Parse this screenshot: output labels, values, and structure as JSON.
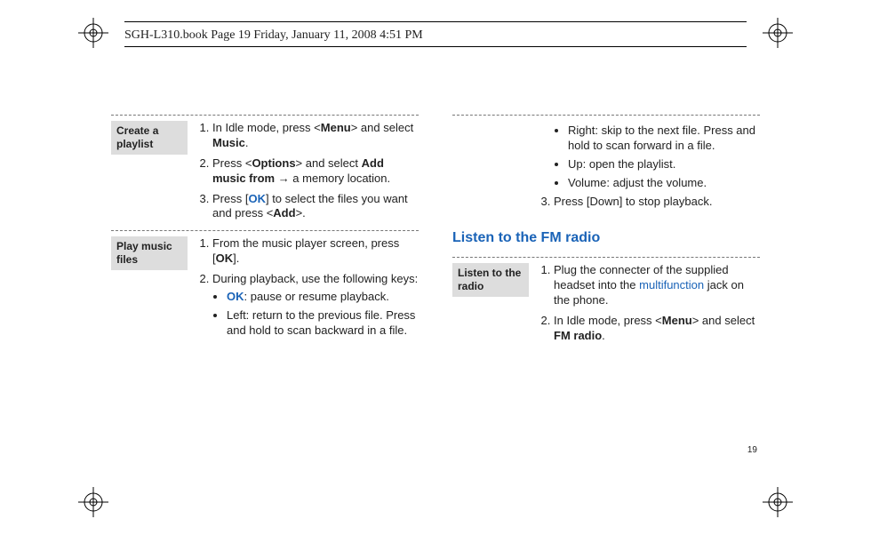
{
  "header": {
    "text": "SGH-L310.book  Page 19  Friday, January 11, 2008  4:51 PM"
  },
  "page_number": "19",
  "section_heading": "Listen to the FM radio",
  "groups": {
    "create_playlist": {
      "label": "Create a playlist",
      "s1_pre": "In Idle mode, press <",
      "s1_menu": "Menu",
      "s1_mid": "> and select ",
      "s1_music": "Music",
      "s1_end": ".",
      "s2_pre": "Press <",
      "s2_options": "Options",
      "s2_mid": "> and select ",
      "s2_addmusic": "Add music from",
      "s2_arrow": " → a memory location.",
      "s3_pre": "Press [",
      "s3_ok": "OK",
      "s3_mid": "] to select the files you want and press <",
      "s3_add": "Add",
      "s3_end": ">."
    },
    "play_music": {
      "label": "Play music files",
      "s1_pre": "From the music player screen, press [",
      "s1_ok": "OK",
      "s1_end": "].",
      "s2": "During playback, use the following keys:",
      "b_ok_pre": "",
      "b_ok_key": "OK",
      "b_ok_post": ": pause or resume playback.",
      "b_left": "Left: return to the previous file. Press and hold to scan backward in a file.",
      "b_right": "Right: skip to the next file. Press and hold to scan forward in a file.",
      "b_up": "Up: open the playlist.",
      "b_volume": "Volume: adjust the volume.",
      "s3": "Press [Down] to stop playback."
    },
    "listen_radio": {
      "label": "Listen to the radio",
      "s1_pre": "Plug the connecter of the supplied headset into the ",
      "s1_link": "multifunction",
      "s1_post": " jack on the phone.",
      "s2_pre": "In Idle mode, press <",
      "s2_menu": "Menu",
      "s2_mid": "> and select ",
      "s2_fm": "FM radio",
      "s2_end": "."
    }
  }
}
